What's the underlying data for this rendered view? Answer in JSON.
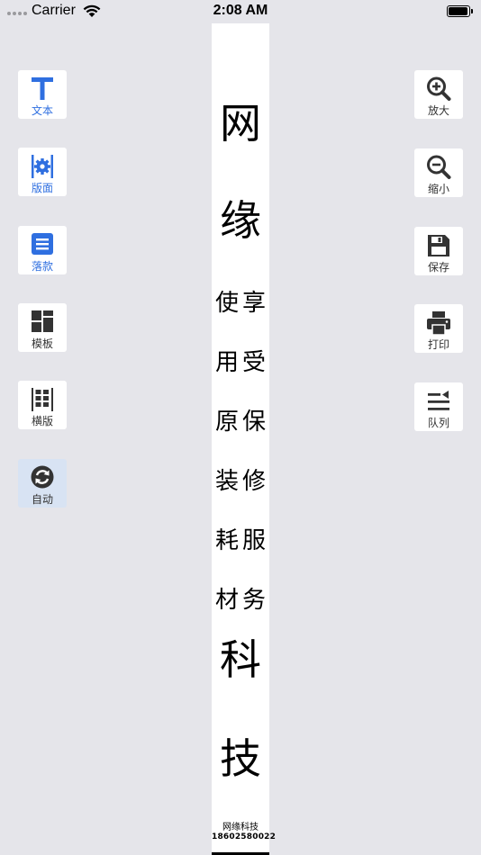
{
  "status_bar": {
    "carrier": "Carrier",
    "time": "2:08 AM"
  },
  "left_tools": [
    {
      "label": "文本",
      "icon": "text-icon"
    },
    {
      "label": "版面",
      "icon": "layout-settings-icon"
    },
    {
      "label": "落款",
      "icon": "inscription-list-icon"
    },
    {
      "label": "模板",
      "icon": "template-grid-icon"
    },
    {
      "label": "横版",
      "icon": "horizontal-layout-icon"
    },
    {
      "label": "自动",
      "icon": "auto-refresh-icon",
      "active": true
    }
  ],
  "right_tools": [
    {
      "label": "放大",
      "icon": "zoom-in-icon"
    },
    {
      "label": "缩小",
      "icon": "zoom-out-icon"
    },
    {
      "label": "保存",
      "icon": "save-icon"
    },
    {
      "label": "打印",
      "icon": "print-icon"
    },
    {
      "label": "队列",
      "icon": "queue-icon"
    }
  ],
  "canvas": {
    "top_chars": [
      "网",
      "缘"
    ],
    "column_right": [
      "享",
      "受",
      "保",
      "修",
      "服",
      "务"
    ],
    "column_left": [
      "使",
      "用",
      "原",
      "装",
      "耗",
      "材"
    ],
    "bottom_chars": [
      "科",
      "技"
    ],
    "signature_name": "网缘科技",
    "signature_phone": "18602580022"
  },
  "colors": {
    "background": "#e5e5ea",
    "accent_blue": "#2f6fe0",
    "active_tint": "#d8e3f3",
    "icon_dark": "#333333"
  }
}
